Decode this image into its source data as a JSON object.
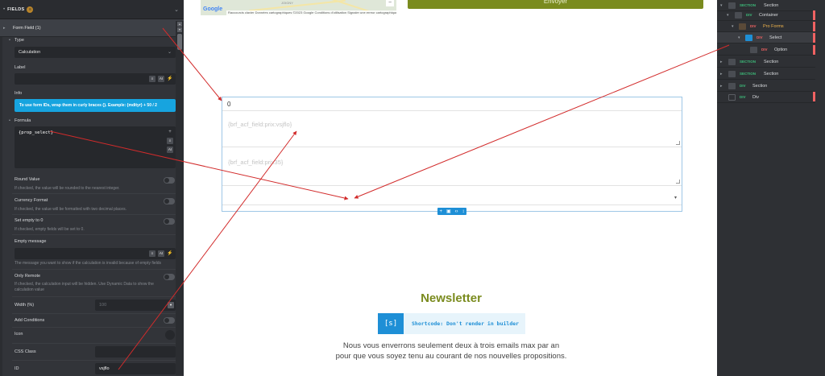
{
  "left_panel": {
    "header": {
      "title": "FIELDS",
      "icon": "list-icon"
    },
    "form_field": {
      "label": "Form Field (1)"
    },
    "type": {
      "label": "Type",
      "value": "Calculation"
    },
    "label_field": {
      "label": "Label",
      "value": ""
    },
    "info": {
      "label": "Info",
      "text": "To use form IDs, wrap them in curly braces {}. Example: {mdityr} + 50 / 2"
    },
    "formula": {
      "label": "Formula",
      "value": "{prop_select}"
    },
    "round_value": {
      "label": "Round Value",
      "help": "If checked, the value will be rounded to the nearest integer."
    },
    "currency_format": {
      "label": "Currency Format",
      "help": "If checked, the value will be formatted with two decimal places."
    },
    "set_empty": {
      "label": "Set empty to 0",
      "help": "If checked, empty fields will be set to 0."
    },
    "empty_message": {
      "label": "Empty message",
      "value": "",
      "help": "The message you want to show if the calculation is invalid because of empty fields"
    },
    "only_remote": {
      "label": "Only Remote",
      "help": "If checked, the calculation input will be hidden. Use Dynamic Data to show the calculation value"
    },
    "width": {
      "label": "Width (%)",
      "placeholder": "100"
    },
    "add_conditions": {
      "label": "Add Conditions"
    },
    "icon_field": {
      "label": "Icon"
    },
    "css_class": {
      "label": "CSS Class",
      "value": ""
    },
    "id_field": {
      "label": "ID",
      "value": "vsjflo"
    },
    "icons": {
      "ai": "AI",
      "plus": "+",
      "bolt": "⚡"
    }
  },
  "canvas": {
    "map": {
      "logo": "Google",
      "attribution": "Raccourcis clavier   Données cartographiques ©2023 Google   Conditions d'utilisation   Signaler une erreur cartographique",
      "zoom_symbol": "−",
      "village": "JOIGNY"
    },
    "send_button": "Envoyer",
    "form": {
      "calc_value": "0",
      "textarea1_placeholder": "{brf_acf_field:prix:vsjflo}",
      "textarea2_placeholder": "{brf_acf_field:prix35}"
    },
    "newsletter": {
      "title": "Newsletter",
      "shortcode_icon": "[s]",
      "shortcode_text": "Shortcode: Don't render in builder",
      "text_line1": "Nous vous enverrons seulement deux à trois emails max par an",
      "text_line2": "pour que vous soyez tenu au courant de nos nouvelles propositions."
    }
  },
  "structure": {
    "rows": [
      {
        "tag": "SECTION",
        "name": "Section"
      },
      {
        "tag": "DIV",
        "name": "Container"
      },
      {
        "tag": "DIV",
        "name": "Pro Forms"
      },
      {
        "tag": "DIV",
        "name": "Select"
      },
      {
        "tag": "DIV",
        "name": "Option"
      },
      {
        "tag": "SECTION",
        "name": "Section"
      },
      {
        "tag": "SECTION",
        "name": "Section"
      },
      {
        "tag": "DIV",
        "name": "Section"
      },
      {
        "tag": "DIV",
        "name": "Div"
      }
    ]
  },
  "colors": {
    "accent_blue": "#1e8fd6",
    "info_blue": "#17a4df",
    "brand_green": "#7a8b1e",
    "arrow_red": "#d22b2b",
    "panel_bg": "#323439"
  }
}
